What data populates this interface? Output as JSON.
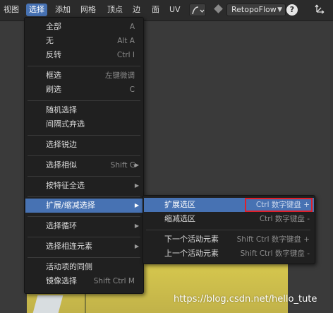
{
  "header": {
    "tabs": [
      "视图",
      "选择",
      "添加",
      "网格",
      "顶点",
      "边",
      "面",
      "UV"
    ],
    "active_tab": "选择",
    "addon_name": "RetopoFlow",
    "help_glyph": "?"
  },
  "select_menu": {
    "items": [
      {
        "label": "全部",
        "shortcut": "A"
      },
      {
        "label": "无",
        "shortcut": "Alt A"
      },
      {
        "label": "反转",
        "shortcut": "Ctrl I"
      },
      {
        "label": "框选",
        "shortcut": "左键微调"
      },
      {
        "label": "刷选",
        "shortcut": "C"
      },
      {
        "label": "随机选择",
        "shortcut": ""
      },
      {
        "label": "间隔式弃选",
        "shortcut": ""
      },
      {
        "label": "选择锐边",
        "shortcut": ""
      },
      {
        "label": "选择相似",
        "shortcut": "Shift G"
      },
      {
        "label": "按特征全选",
        "shortcut": ""
      },
      {
        "label": "扩展/缩减选择",
        "shortcut": ""
      },
      {
        "label": "选择循环",
        "shortcut": ""
      },
      {
        "label": "选择相连元素",
        "shortcut": ""
      },
      {
        "label": "活动项的同侧",
        "shortcut": ""
      },
      {
        "label": "镜像选择",
        "shortcut": "Shift Ctrl M"
      }
    ],
    "arrow_glyph": "▶"
  },
  "submenu": {
    "items": [
      {
        "label": "扩展选区",
        "shortcut": "Ctrl 数字键盘 +"
      },
      {
        "label": "缩减选区",
        "shortcut": "Ctrl 数字键盘 -"
      },
      {
        "label": "下一个活动元素",
        "shortcut": "Shift Ctrl 数字键盘 +"
      },
      {
        "label": "上一个活动元素",
        "shortcut": "Shift Ctrl 数字键盘 -"
      }
    ]
  },
  "watermark": "https://blog.csdn.net/hello_tute",
  "colors": {
    "accent": "#4772b3",
    "menu_bg": "#202020",
    "highlight_box": "#e0202a",
    "object": "#d8c94e"
  }
}
